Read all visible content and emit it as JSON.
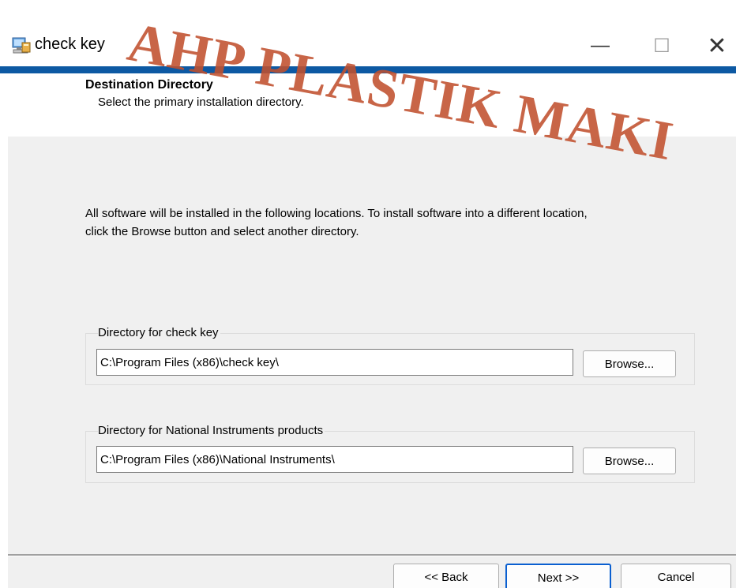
{
  "window": {
    "title": "check key",
    "icon": "installer-icon",
    "controls": {
      "minimize": "—",
      "maximize": "☐",
      "close": "✕"
    }
  },
  "header": {
    "title": "Destination Directory",
    "subtitle": "Select the primary installation directory."
  },
  "description": "All software will be installed in the following locations. To install software into a different location, click the Browse button and select another directory.",
  "groups": [
    {
      "label": "Directory for check key",
      "path": "C:\\Program Files (x86)\\check key\\",
      "browse_label": "Browse..."
    },
    {
      "label": "Directory for National Instruments products",
      "path": "C:\\Program Files (x86)\\National Instruments\\",
      "browse_label": "Browse..."
    }
  ],
  "buttons": {
    "back": "<< Back",
    "next": "Next >>",
    "cancel": "Cancel"
  },
  "watermark": "AHP PLASTIK MAKI",
  "colors": {
    "accent_bar": "#0d59a3",
    "focus_border": "#0a5fd0",
    "watermark": "#c0502d"
  }
}
